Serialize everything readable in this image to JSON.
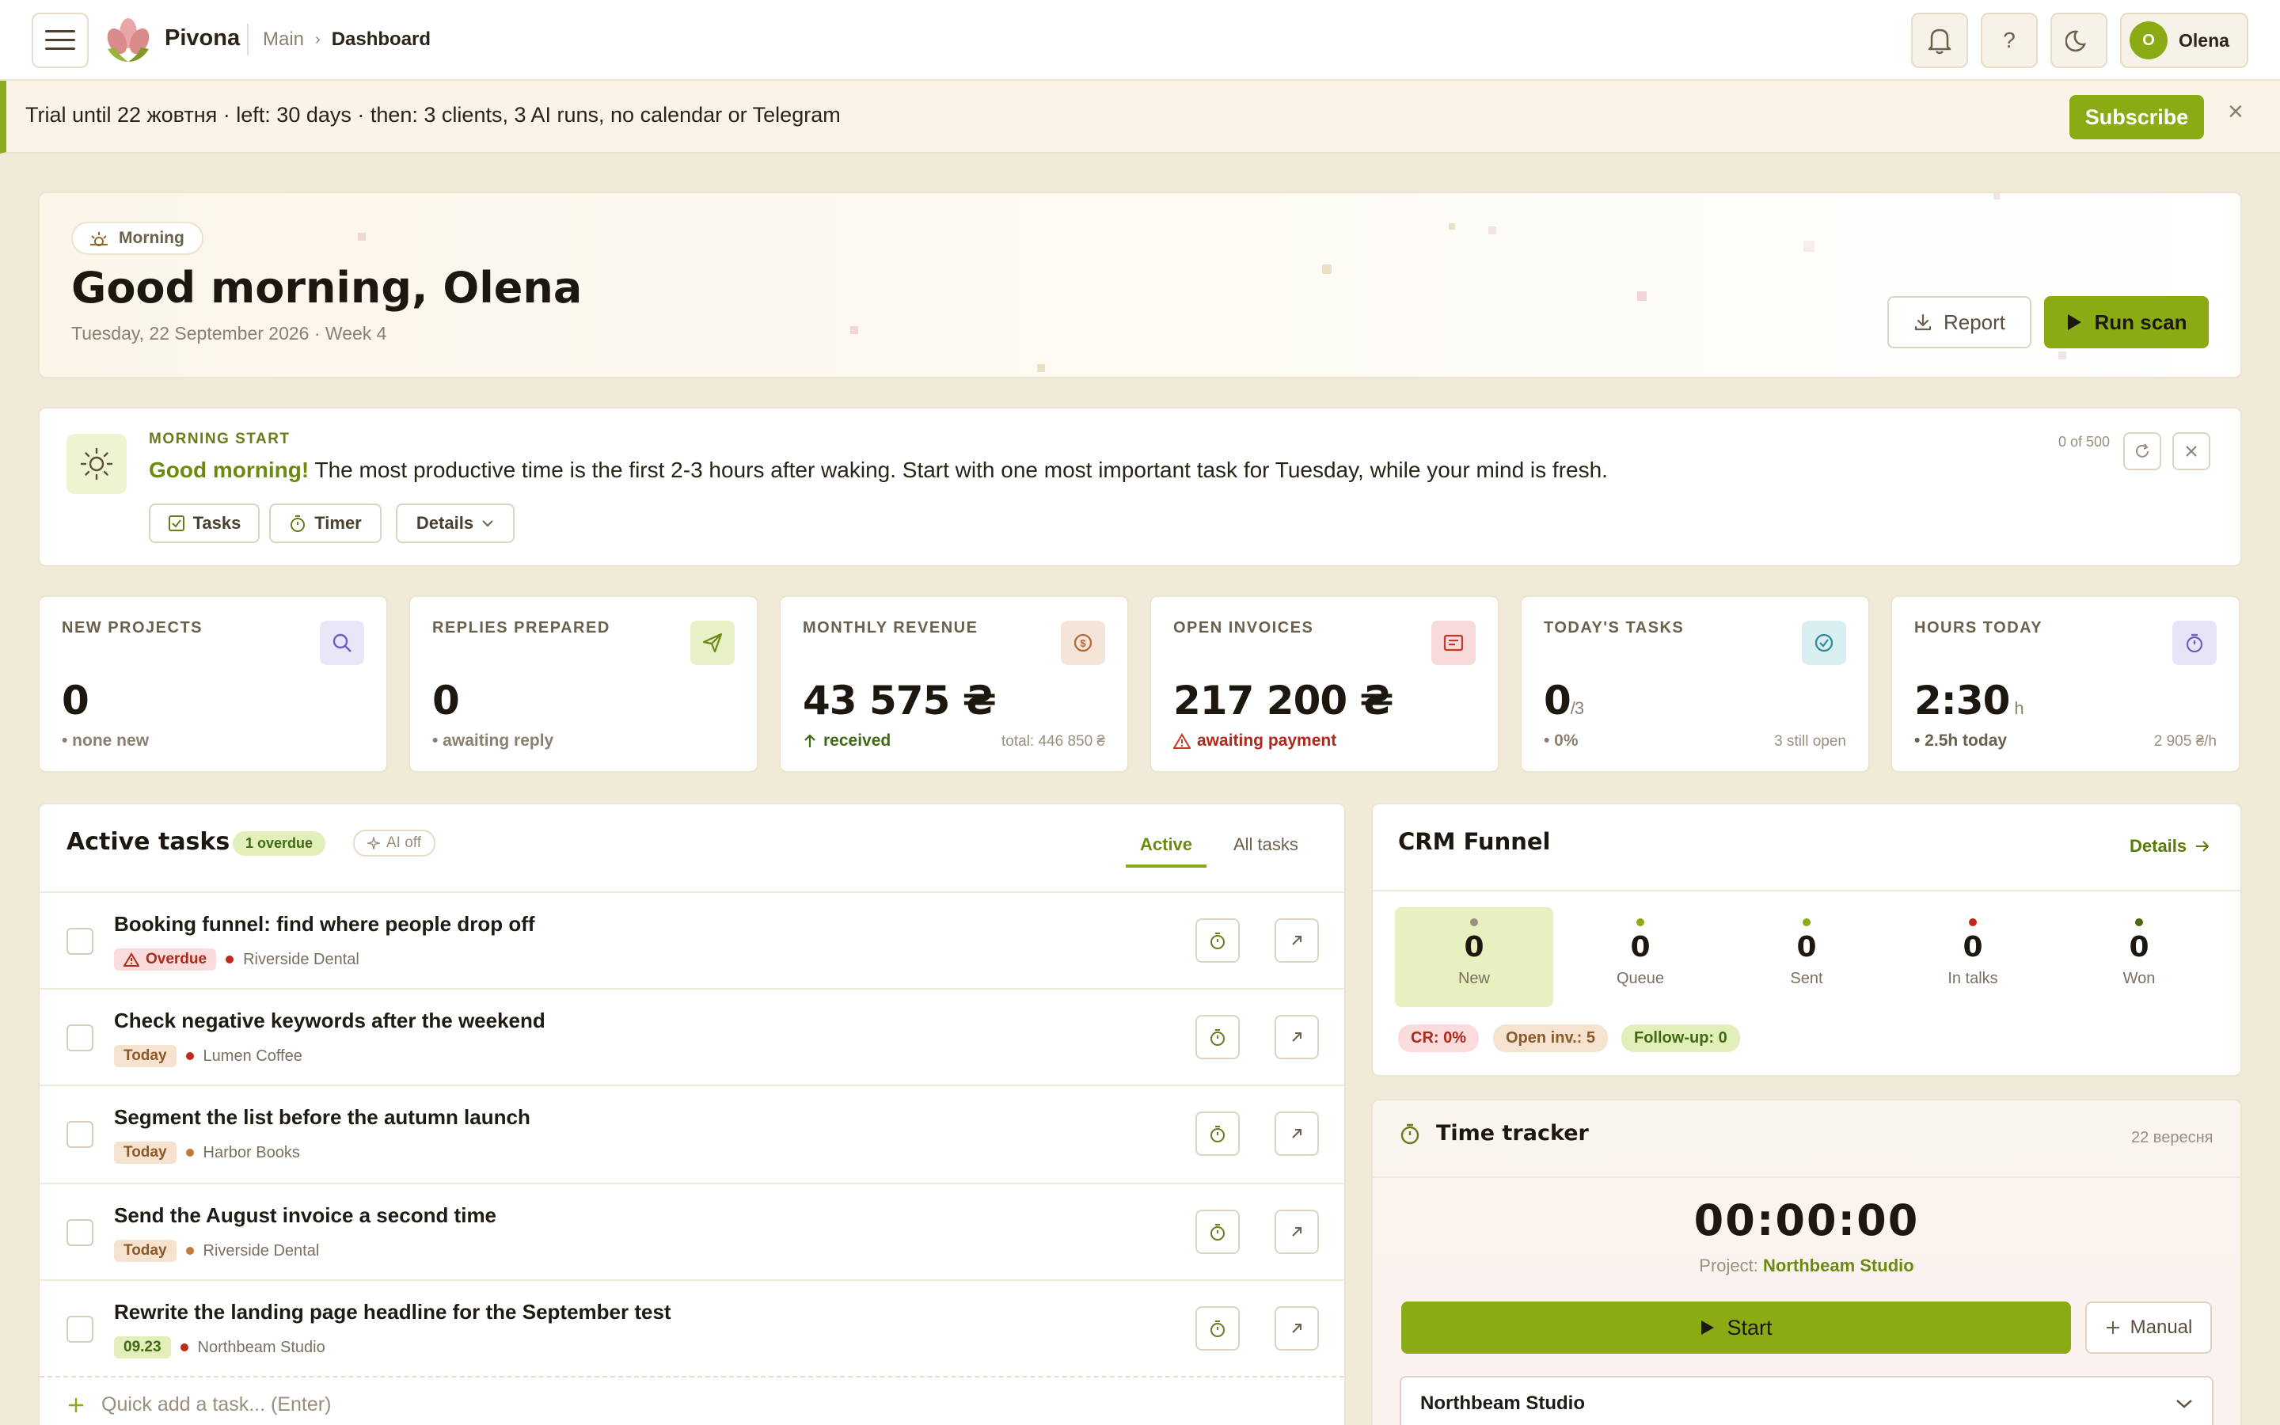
{
  "header": {
    "brand": "Pivona",
    "crumb_root": "Main",
    "crumb_current": "Dashboard",
    "help": "?",
    "user_initial": "O",
    "user_name": "Olena"
  },
  "trial": {
    "text": "Trial until 22 жовтня · left: 30 days · then: 3 clients, 3 AI runs, no calendar or Telegram",
    "subscribe": "Subscribe",
    "close": "×"
  },
  "hero": {
    "badge": "Morning",
    "title": "Good morning, Olena",
    "date": "Tuesday, 22 September 2026 · Week 4",
    "report": "Report",
    "run": "Run scan"
  },
  "tip": {
    "kicker": "MORNING START",
    "lead": "Good morning!",
    "text": "The most productive time is the first 2-3 hours after waking. Start with one most important task for Tuesday, while your mind is fresh.",
    "counter": "0 of 500",
    "tasks_btn": "Tasks",
    "timer_btn": "Timer",
    "details_btn": "Details"
  },
  "stats": [
    {
      "label": "NEW PROJECTS",
      "value": "0",
      "unit": "",
      "sub": "• none new",
      "sub2": ""
    },
    {
      "label": "REPLIES PREPARED",
      "value": "0",
      "unit": "",
      "sub": "• awaiting reply",
      "sub2": ""
    },
    {
      "label": "MONTHLY REVENUE",
      "value": "43 575 ₴",
      "unit": "",
      "sub": "received",
      "sub2": "total: 446 850 ₴"
    },
    {
      "label": "OPEN INVOICES",
      "value": "217 200 ₴",
      "unit": "",
      "sub": "awaiting payment",
      "sub2": ""
    },
    {
      "label": "TODAY'S TASKS",
      "value": "0",
      "unit": "/3",
      "sub": "• 0%",
      "sub2": "3 still open"
    },
    {
      "label": "HOURS TODAY",
      "value": "2:30",
      "unit": "h",
      "sub": "• 2.5h today",
      "sub2": "2 905 ₴/h"
    }
  ],
  "tasks": {
    "title": "Active tasks",
    "overdue": "1 overdue",
    "ai": "AI off",
    "tab_active": "Active",
    "tab_all": "All tasks",
    "quick_add": "Quick add a task... (Enter)",
    "items": [
      {
        "title": "Booking funnel: find where people drop off",
        "tag": "Overdue",
        "client": "Riverside Dental"
      },
      {
        "title": "Check negative keywords after the weekend",
        "tag": "Today",
        "client": "Lumen Coffee"
      },
      {
        "title": "Segment the list before the autumn launch",
        "tag": "Today",
        "client": "Harbor Books"
      },
      {
        "title": "Send the August invoice a second time",
        "tag": "Today",
        "client": "Riverside Dental"
      },
      {
        "title": "Rewrite the landing page headline for the September test",
        "tag": "09.23",
        "client": "Northbeam Studio"
      }
    ]
  },
  "crm": {
    "title": "CRM Funnel",
    "details": "Details",
    "stages": [
      {
        "label": "New",
        "value": "0"
      },
      {
        "label": "Queue",
        "value": "0"
      },
      {
        "label": "Sent",
        "value": "0"
      },
      {
        "label": "In talks",
        "value": "0"
      },
      {
        "label": "Won",
        "value": "0"
      }
    ],
    "cr": "CR: 0%",
    "open_inv": "Open inv.: 5",
    "followup": "Follow-up: 0"
  },
  "tracker": {
    "title": "Time tracker",
    "date": "22 вересня",
    "time": "00:00:00",
    "project_label": "Project:",
    "project": "Northbeam Studio",
    "start": "Start",
    "manual": "Manual",
    "select": "Northbeam Studio"
  },
  "colors": {
    "accent": "#8aab13",
    "danger": "#c0392b",
    "brand": "#d98a8a"
  }
}
